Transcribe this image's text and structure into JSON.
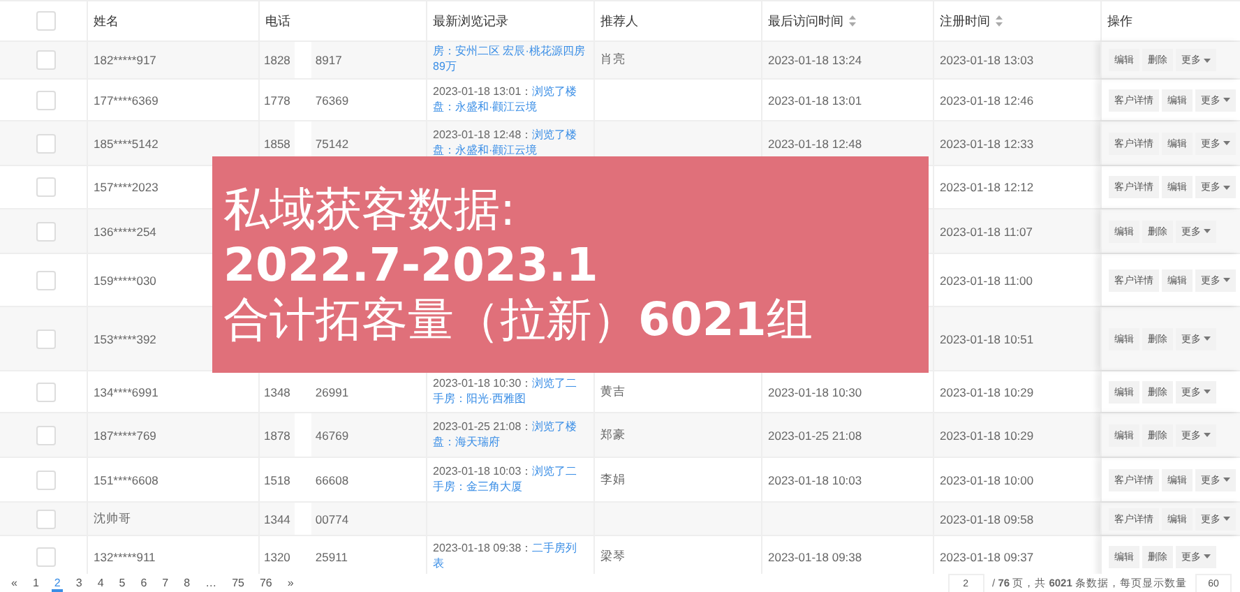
{
  "table": {
    "header_checkbox": {
      "checked": false
    },
    "columns": [
      {
        "label": "姓名",
        "sortable": false
      },
      {
        "label": "电话",
        "sortable": false
      },
      {
        "label": "最新浏览记录",
        "sortable": false
      },
      {
        "label": "推荐人",
        "sortable": false
      },
      {
        "label": "最后访问时间",
        "sortable": true
      },
      {
        "label": "注册时间",
        "sortable": true
      },
      {
        "label": "操作",
        "sortable": false
      }
    ],
    "rows": [
      {
        "checked": false,
        "name": "182*****917",
        "phone_head": "1828",
        "phone_tail": "8917",
        "browse": {
          "link": "房：安州二区 宏辰·桃花源四房89万"
        },
        "referrer": "肖亮",
        "last_visit": "2023-01-18 13:24",
        "registered": "2023-01-18 13:03",
        "actions": [
          {
            "kind": "button",
            "label": "编辑"
          },
          {
            "kind": "button",
            "label": "删除"
          },
          {
            "kind": "dropdown",
            "label": "更多"
          }
        ]
      },
      {
        "checked": false,
        "name": "177****6369",
        "phone_head": "1778",
        "phone_tail": "76369",
        "browse": {
          "time": "2023-01-18 13:01：",
          "link": "浏览了楼盘：永盛和·颧江云境"
        },
        "last_visit": "2023-01-18 13:01",
        "registered": "2023-01-18 12:46",
        "actions": [
          {
            "kind": "button",
            "label": "客户详情"
          },
          {
            "kind": "button",
            "label": "编辑"
          },
          {
            "kind": "dropdown",
            "label": "更多"
          }
        ]
      },
      {
        "checked": false,
        "name": "185****5142",
        "phone_head": "1858",
        "phone_tail": "75142",
        "browse": {
          "time": "2023-01-18 12:48：",
          "link": "浏览了楼盘：永盛和·颧江云境"
        },
        "last_visit": "2023-01-18 12:48",
        "registered": "2023-01-18 12:33",
        "actions": [
          {
            "kind": "button",
            "label": "客户详情"
          },
          {
            "kind": "button",
            "label": "编辑"
          },
          {
            "kind": "dropdown",
            "label": "更多"
          }
        ]
      },
      {
        "checked": false,
        "name": "157****2023",
        "registered": "2023-01-18 12:12",
        "actions": [
          {
            "kind": "button",
            "label": "客户详情"
          },
          {
            "kind": "button",
            "label": "编辑"
          },
          {
            "kind": "dropdown",
            "label": "更多"
          }
        ]
      },
      {
        "checked": false,
        "name": "136*****254",
        "registered": "2023-01-18 11:07",
        "actions": [
          {
            "kind": "button",
            "label": "编辑"
          },
          {
            "kind": "button",
            "label": "删除"
          },
          {
            "kind": "dropdown",
            "label": "更多"
          }
        ]
      },
      {
        "checked": false,
        "name": "159*****030",
        "registered": "2023-01-18 11:00",
        "actions": [
          {
            "kind": "button",
            "label": "客户详情"
          },
          {
            "kind": "button",
            "label": "编辑"
          },
          {
            "kind": "dropdown",
            "label": "更多"
          }
        ]
      },
      {
        "checked": false,
        "name": "153*****392",
        "registered": "2023-01-18 10:51",
        "actions": [
          {
            "kind": "button",
            "label": "编辑"
          },
          {
            "kind": "button",
            "label": "删除"
          },
          {
            "kind": "dropdown",
            "label": "更多"
          }
        ]
      },
      {
        "checked": false,
        "name": "134****6991",
        "phone_head": "1348",
        "phone_tail": "26991",
        "browse": {
          "time": "2023-01-18 10:30：",
          "link": "浏览了二手房：阳光·西雅图"
        },
        "referrer": "黄吉",
        "last_visit": "2023-01-18 10:30",
        "registered": "2023-01-18 10:29",
        "actions": [
          {
            "kind": "button",
            "label": "编辑"
          },
          {
            "kind": "button",
            "label": "删除"
          },
          {
            "kind": "dropdown",
            "label": "更多"
          }
        ]
      },
      {
        "checked": false,
        "name": "187*****769",
        "phone_head": "1878",
        "phone_tail": "46769",
        "browse": {
          "time": "2023-01-25 21:08：",
          "link": "浏览了楼盘：海天瑞府"
        },
        "referrer": "郑豪",
        "last_visit": "2023-01-25 21:08",
        "registered": "2023-01-18 10:29",
        "actions": [
          {
            "kind": "button",
            "label": "编辑"
          },
          {
            "kind": "button",
            "label": "删除"
          },
          {
            "kind": "dropdown",
            "label": "更多"
          }
        ]
      },
      {
        "checked": false,
        "name": "151****6608",
        "phone_head": "1518",
        "phone_tail": "66608",
        "browse": {
          "time": "2023-01-18 10:03：",
          "link": "浏览了二手房：金三角大厦"
        },
        "referrer": "李娟",
        "last_visit": "2023-01-18 10:03",
        "registered": "2023-01-18 10:00",
        "actions": [
          {
            "kind": "button",
            "label": "客户详情"
          },
          {
            "kind": "button",
            "label": "编辑"
          },
          {
            "kind": "dropdown",
            "label": "更多"
          }
        ]
      },
      {
        "checked": false,
        "name": "沈帅哥",
        "phone_head": "1344",
        "phone_tail": "00774",
        "registered": "2023-01-18 09:58",
        "actions": [
          {
            "kind": "button",
            "label": "客户详情"
          },
          {
            "kind": "button",
            "label": "编辑"
          },
          {
            "kind": "dropdown",
            "label": "更多"
          }
        ]
      },
      {
        "checked": false,
        "name": "132*****911",
        "phone_head": "1320",
        "phone_tail": "25911",
        "browse": {
          "time": "2023-01-18 09:38：",
          "link": "二手房列表"
        },
        "referrer": "梁琴",
        "last_visit": "2023-01-18 09:38",
        "registered": "2023-01-18 09:37",
        "actions": [
          {
            "kind": "button",
            "label": "编辑"
          },
          {
            "kind": "button",
            "label": "删除"
          },
          {
            "kind": "dropdown",
            "label": "更多"
          }
        ]
      }
    ]
  },
  "banner": {
    "lines": [
      "私域获客数据:",
      "**2022.7-2023.1**",
      "合计拓客量（拉新）**6021**组"
    ]
  },
  "pagination": {
    "prev": "«",
    "pages": [
      {
        "label": "1",
        "selected": false
      },
      {
        "label": "2",
        "selected": true
      },
      {
        "label": "3",
        "selected": false
      },
      {
        "label": "4",
        "selected": false
      },
      {
        "label": "5",
        "selected": false
      },
      {
        "label": "6",
        "selected": false
      },
      {
        "label": "7",
        "selected": false
      },
      {
        "label": "8",
        "selected": false
      },
      {
        "label": "…",
        "selected": false
      },
      {
        "label": "75",
        "selected": false
      },
      {
        "label": "76",
        "selected": false
      }
    ],
    "next": "»",
    "page_input": "2",
    "summary": "/ **76** 页，共 **6021** 条数据，每页显示数量",
    "page_size": "60"
  }
}
